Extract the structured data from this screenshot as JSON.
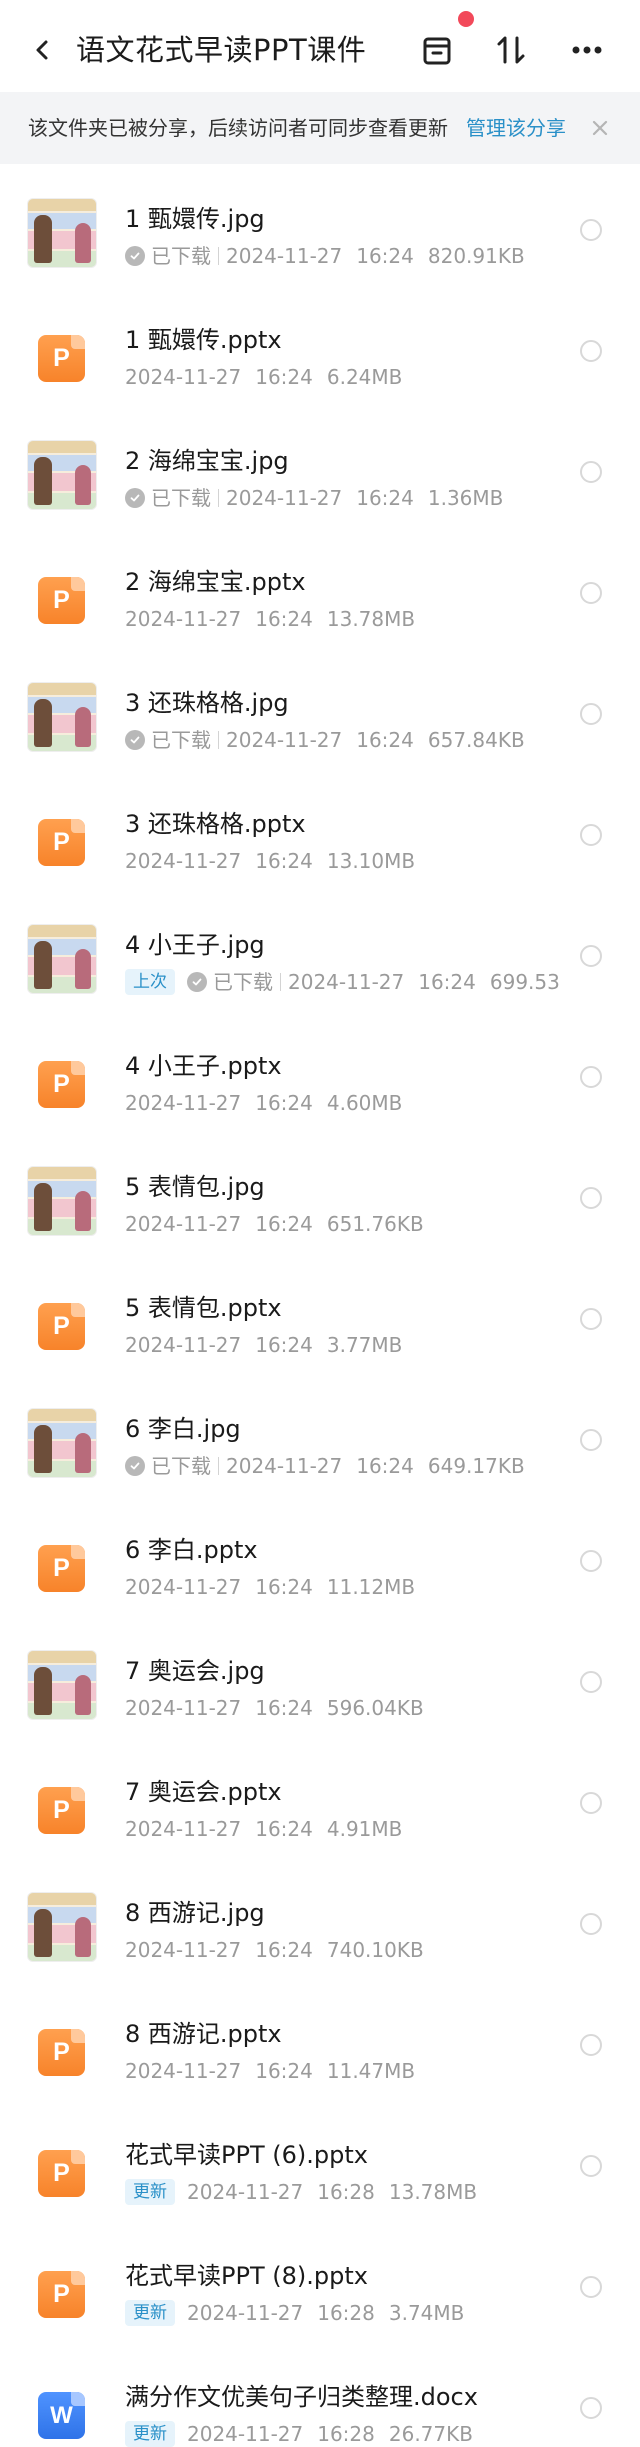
{
  "header": {
    "title": "语文花式早读PPT课件",
    "back_icon": "back-arrow-icon",
    "actions": [
      "box-icon",
      "sort-icon",
      "more-icon"
    ],
    "notification_dot_color": "#f2495a"
  },
  "banner": {
    "text": "该文件夹已被分享，后续访问者可同步查看更新",
    "link": "管理该分享",
    "close_icon": "close-icon",
    "link_color": "#2a90c8"
  },
  "files": [
    {
      "name": "1 甄嬛传.jpg",
      "type": "image",
      "badge": "",
      "status": "已下载",
      "date": "2024-11-27",
      "time": "16:24",
      "size": "820.91KB"
    },
    {
      "name": "1 甄嬛传.pptx",
      "type": "pptx",
      "badge": "",
      "status": "",
      "date": "2024-11-27",
      "time": "16:24",
      "size": "6.24MB"
    },
    {
      "name": "2 海绵宝宝.jpg",
      "type": "image",
      "badge": "",
      "status": "已下载",
      "date": "2024-11-27",
      "time": "16:24",
      "size": "1.36MB"
    },
    {
      "name": "2 海绵宝宝.pptx",
      "type": "pptx",
      "badge": "",
      "status": "",
      "date": "2024-11-27",
      "time": "16:24",
      "size": "13.78MB"
    },
    {
      "name": "3 还珠格格.jpg",
      "type": "image",
      "badge": "",
      "status": "已下载",
      "date": "2024-11-27",
      "time": "16:24",
      "size": "657.84KB"
    },
    {
      "name": "3 还珠格格.pptx",
      "type": "pptx",
      "badge": "",
      "status": "",
      "date": "2024-11-27",
      "time": "16:24",
      "size": "13.10MB"
    },
    {
      "name": "4 小王子.jpg",
      "type": "image",
      "badge": "上次",
      "status": "已下载",
      "date": "2024-11-27",
      "time": "16:24",
      "size": "699.53"
    },
    {
      "name": "4 小王子.pptx",
      "type": "pptx",
      "badge": "",
      "status": "",
      "date": "2024-11-27",
      "time": "16:24",
      "size": "4.60MB"
    },
    {
      "name": "5 表情包.jpg",
      "type": "image",
      "badge": "",
      "status": "",
      "date": "2024-11-27",
      "time": "16:24",
      "size": "651.76KB"
    },
    {
      "name": "5 表情包.pptx",
      "type": "pptx",
      "badge": "",
      "status": "",
      "date": "2024-11-27",
      "time": "16:24",
      "size": "3.77MB"
    },
    {
      "name": "6 李白.jpg",
      "type": "image",
      "badge": "",
      "status": "已下载",
      "date": "2024-11-27",
      "time": "16:24",
      "size": "649.17KB"
    },
    {
      "name": "6 李白.pptx",
      "type": "pptx",
      "badge": "",
      "status": "",
      "date": "2024-11-27",
      "time": "16:24",
      "size": "11.12MB"
    },
    {
      "name": "7 奥运会.jpg",
      "type": "image",
      "badge": "",
      "status": "",
      "date": "2024-11-27",
      "time": "16:24",
      "size": "596.04KB"
    },
    {
      "name": "7 奥运会.pptx",
      "type": "pptx",
      "badge": "",
      "status": "",
      "date": "2024-11-27",
      "time": "16:24",
      "size": "4.91MB"
    },
    {
      "name": "8 西游记.jpg",
      "type": "image",
      "badge": "",
      "status": "",
      "date": "2024-11-27",
      "time": "16:24",
      "size": "740.10KB"
    },
    {
      "name": "8 西游记.pptx",
      "type": "pptx",
      "badge": "",
      "status": "",
      "date": "2024-11-27",
      "time": "16:24",
      "size": "11.47MB"
    },
    {
      "name": "花式早读PPT (6).pptx",
      "type": "pptx",
      "badge": "更新",
      "status": "",
      "date": "2024-11-27",
      "time": "16:28",
      "size": "13.78MB"
    },
    {
      "name": "花式早读PPT (8).pptx",
      "type": "pptx",
      "badge": "更新",
      "status": "",
      "date": "2024-11-27",
      "time": "16:28",
      "size": "3.74MB"
    },
    {
      "name": "满分作文优美句子归类整理.docx",
      "type": "docx",
      "badge": "更新",
      "status": "",
      "date": "2024-11-27",
      "time": "16:28",
      "size": "26.77KB"
    }
  ]
}
